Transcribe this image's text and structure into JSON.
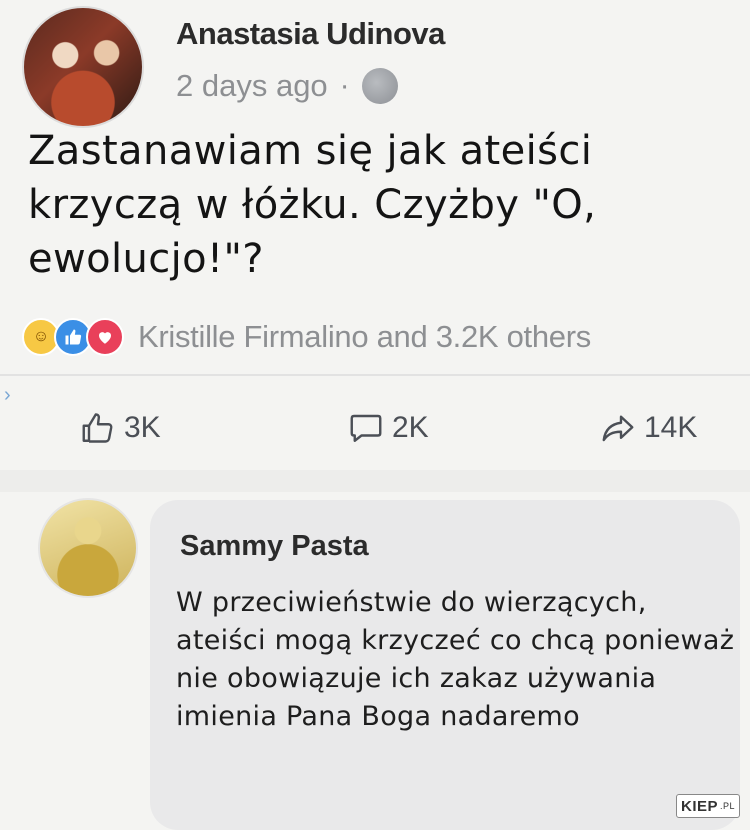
{
  "post": {
    "author": "Anastasia Udinova",
    "timestamp": "2 days ago",
    "separator": "·",
    "privacy_icon": "globe-icon",
    "text": "Zastanawiam się jak ateiści krzyczą w łóżku. Czyżby \"O, ewolucjo!\"?",
    "reactions": {
      "icons": [
        "haha-reaction-icon",
        "like-reaction-icon",
        "love-reaction-icon"
      ],
      "summary": "Kristille Firmalino and 3.2K others"
    },
    "actions": {
      "likes": "3K",
      "comments": "2K",
      "shares": "14K"
    }
  },
  "comment": {
    "author": "Sammy Pasta",
    "text": "W przeciwieństwie do wierzących, ateiści mogą krzyczeć co chcą ponieważ nie obowiązuje ich zakaz używania imienia Pana Boga nadaremo"
  },
  "watermark": {
    "brand": "KIEP",
    "suffix": ".PL"
  },
  "colors": {
    "background": "#f4f4f2",
    "muted_text": "#8d8f92",
    "bubble": "#e9e9ea",
    "like_blue": "#3b8fe6",
    "love_red": "#e9405a",
    "haha_yellow": "#f7c844"
  }
}
